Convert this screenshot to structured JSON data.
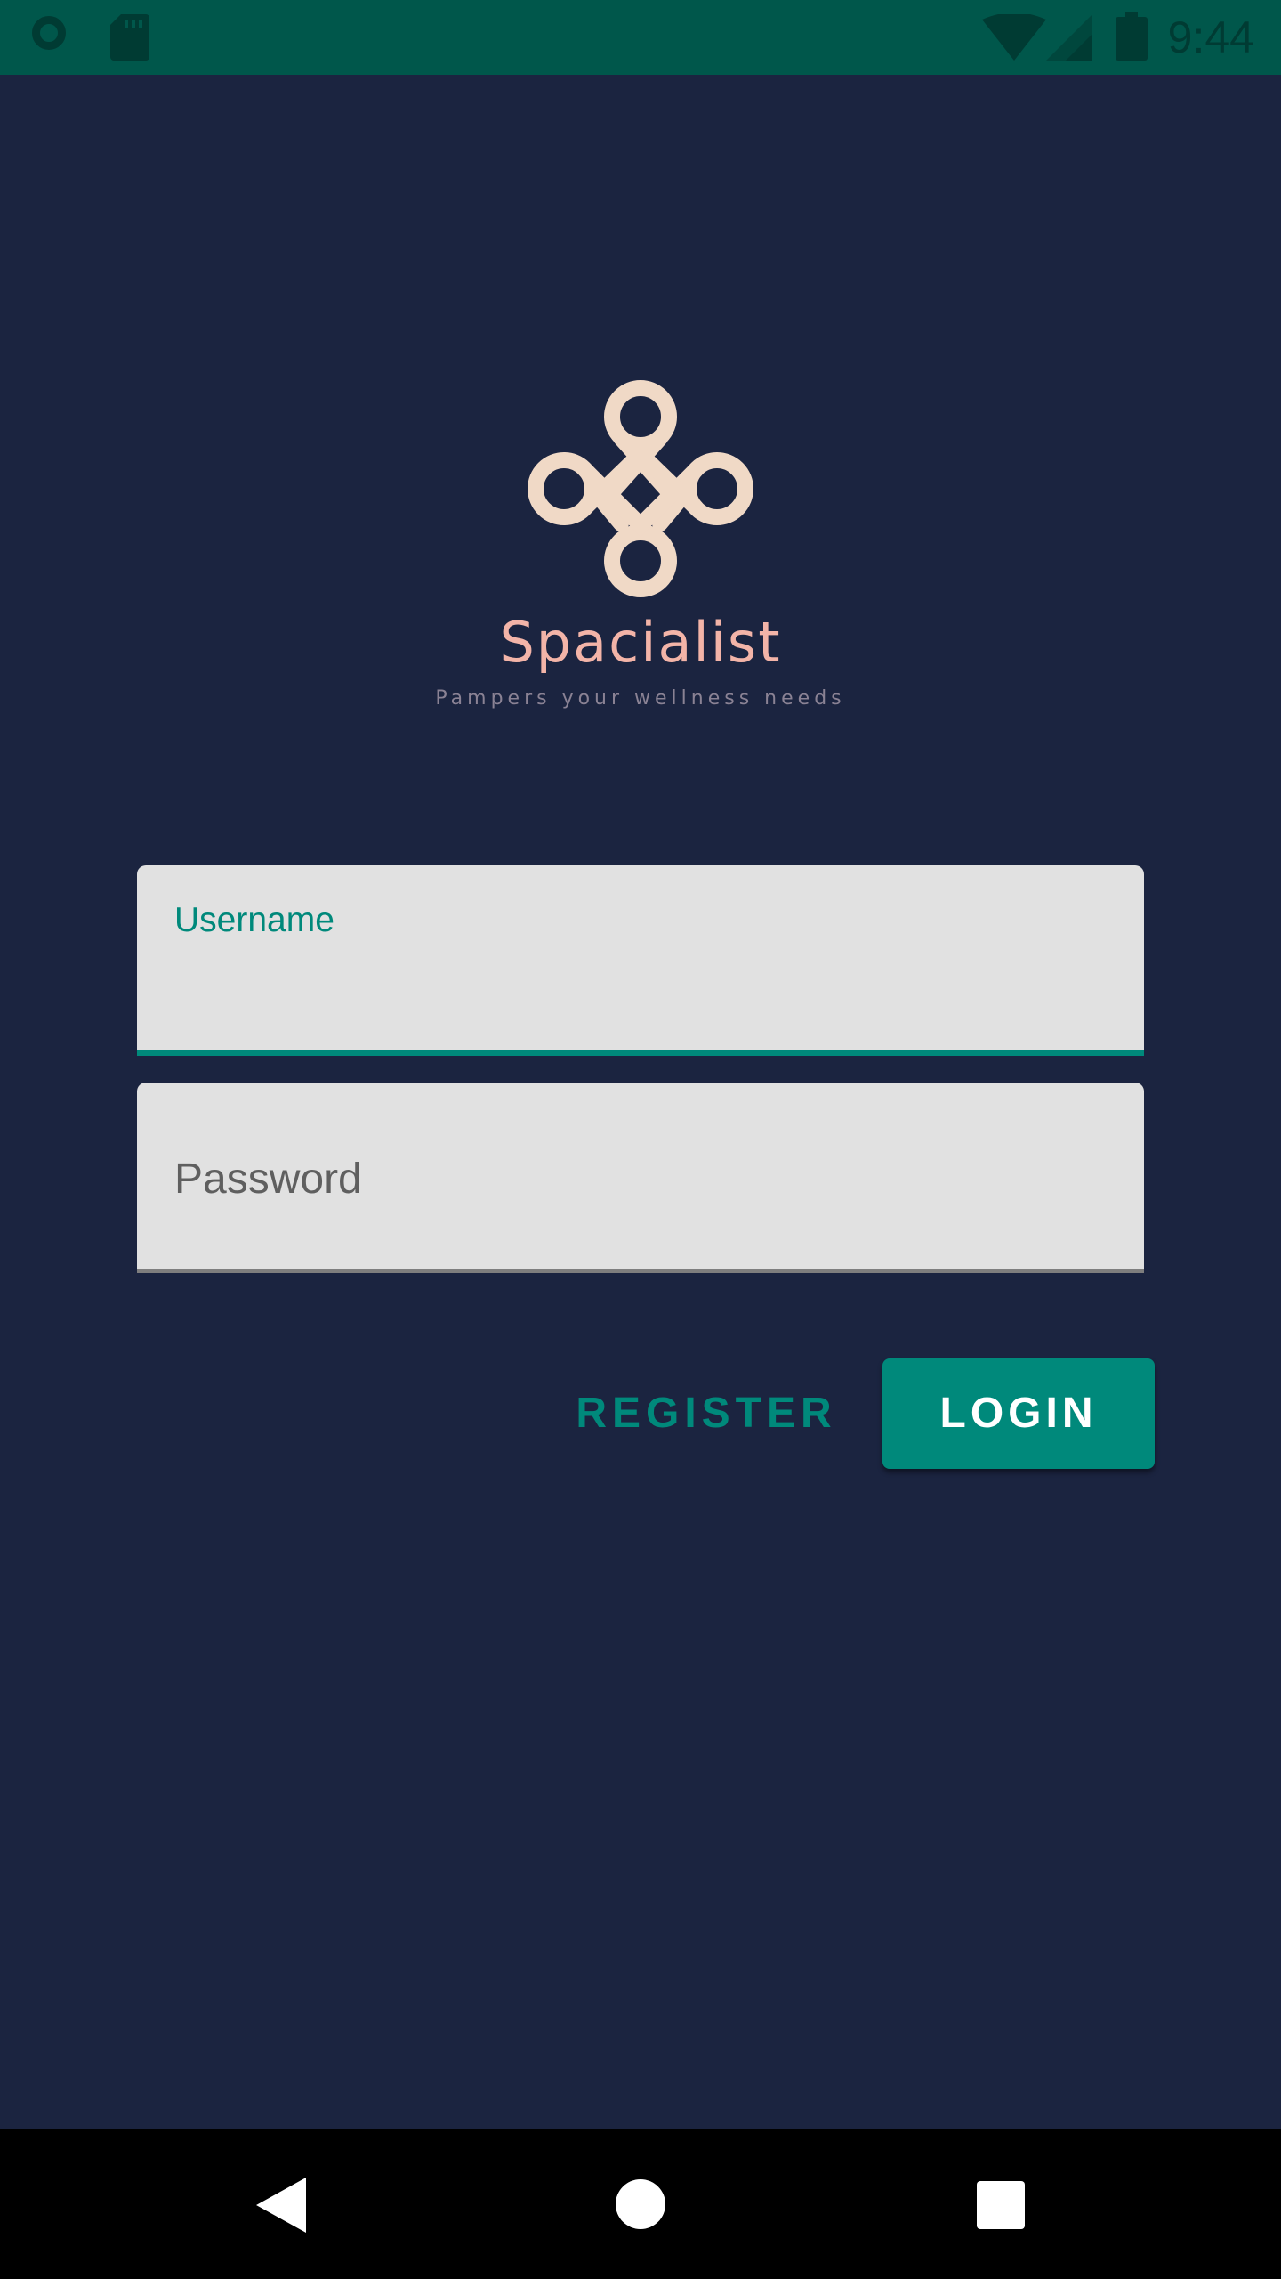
{
  "status_bar": {
    "time": "9:44",
    "icons": [
      "notification-circle-icon",
      "sd-card-icon",
      "wifi-icon",
      "cell-signal-icon",
      "battery-icon"
    ]
  },
  "brand": {
    "name": "Spacialist",
    "tagline": "Pampers your wellness needs",
    "logo_icon": "knot-logo-icon"
  },
  "form": {
    "username": {
      "label": "Username",
      "value": ""
    },
    "password": {
      "placeholder": "Password",
      "value": ""
    }
  },
  "actions": {
    "register_label": "REGISTER",
    "login_label": "LOGIN"
  },
  "nav_bar": {
    "icons": [
      "back-icon",
      "home-icon",
      "recents-icon"
    ]
  },
  "colors": {
    "background": "#1b2440",
    "status_bar": "#00574b",
    "accent": "#00897b",
    "brand_text": "#f3b4a8",
    "logo": "#f0d9c6",
    "field_bg": "#e1e1e1"
  }
}
